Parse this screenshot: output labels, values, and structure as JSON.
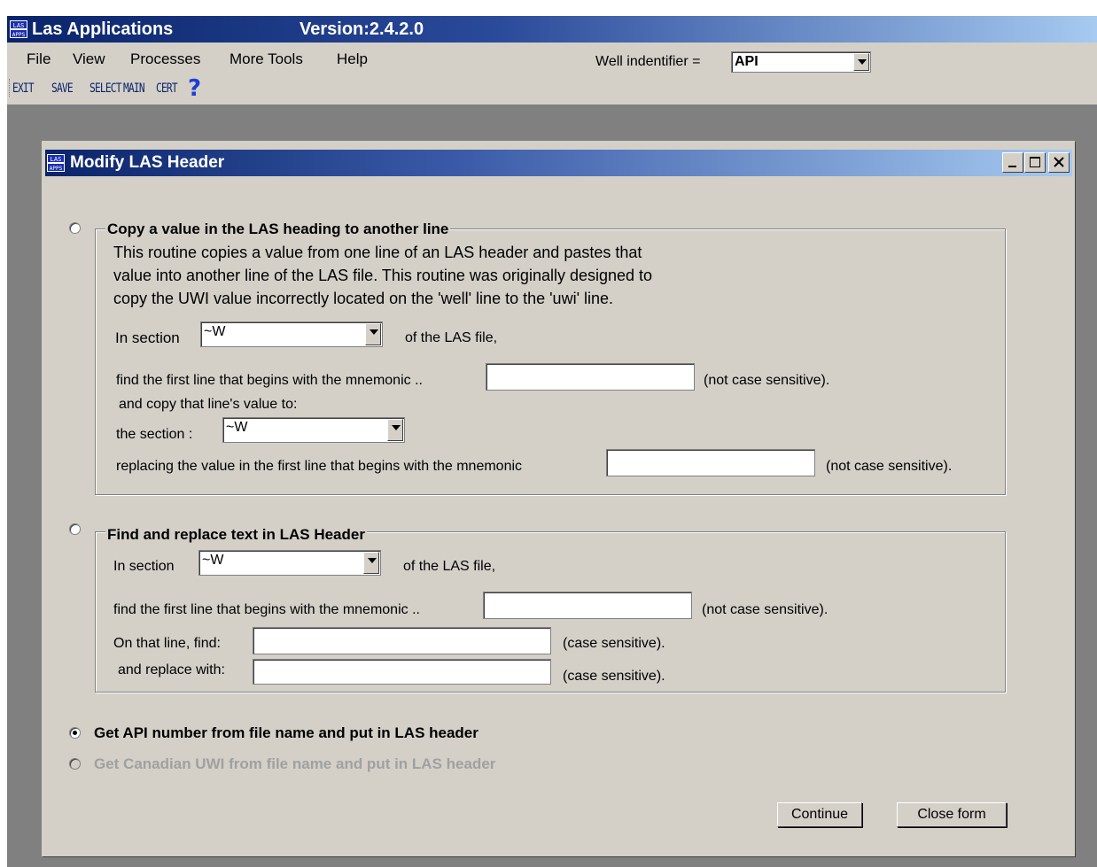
{
  "app": {
    "title": "Las Applications",
    "version": "Version:2.4.2.0",
    "logo": "LAS APPS logo"
  },
  "menu": {
    "items": [
      "File",
      "View",
      "Processes",
      "More Tools",
      "Help"
    ],
    "well_identifier_label": "Well indentifier =",
    "well_identifier_value": "API"
  },
  "toolbar": {
    "buttons": [
      "EXIT",
      "SAVE",
      "SELECT",
      "MAIN",
      "CERT"
    ],
    "help_icon": "help-question-icon"
  },
  "form": {
    "title": "Modify LAS Header",
    "window_buttons": [
      "minimize",
      "maximize",
      "close"
    ],
    "section1": {
      "legend": "Copy a value in the LAS heading to another line",
      "description": [
        "This routine copies a value from one line of an LAS header and pastes that",
        "value into another line of the LAS file. This routine was originally designed to",
        "copy the UWI value incorrectly located on the 'well' line to the 'uwi' line."
      ],
      "in_section_label": "In section",
      "in_section_value": "~W",
      "of_file_label": "of the LAS file,",
      "find_label": "find the first line that begins with the mnemonic ..",
      "find_value": "",
      "not_case_sensitive": "(not case sensitive).",
      "copy_label": "and copy that line's value to:",
      "the_section_label": "the section :",
      "the_section_value": "~W",
      "replace_label": "replacing the value in the first line that begins with the mnemonic",
      "replace_value": "",
      "not_case_sensitive_2": "(not case sensitive)."
    },
    "section2": {
      "legend": "Find and replace text in LAS Header",
      "in_section_label": "In section",
      "in_section_value": "~W",
      "of_file_label": "of the LAS file,",
      "find_label": "find the first line that begins with the mnemonic ..",
      "find_value": "",
      "not_case_sensitive": "(not case sensitive).",
      "on_line_find_label": "On that line, find:",
      "on_line_find_value": "",
      "case_sensitive_1": "(case sensitive).",
      "replace_with_label": "and replace with:",
      "replace_with_value": "",
      "case_sensitive_2": "(case sensitive)."
    },
    "option_api": "Get API number from file name and put in LAS header",
    "option_uwi": "Get Canadian UWI from file name and put in LAS header",
    "continue_label": "Continue",
    "close_label": "Close form"
  },
  "colors": {
    "titlebar_start": "#0a246a",
    "titlebar_end": "#a6caf0",
    "window_bg": "#d4d0c8",
    "mdi_bg": "#808080"
  }
}
